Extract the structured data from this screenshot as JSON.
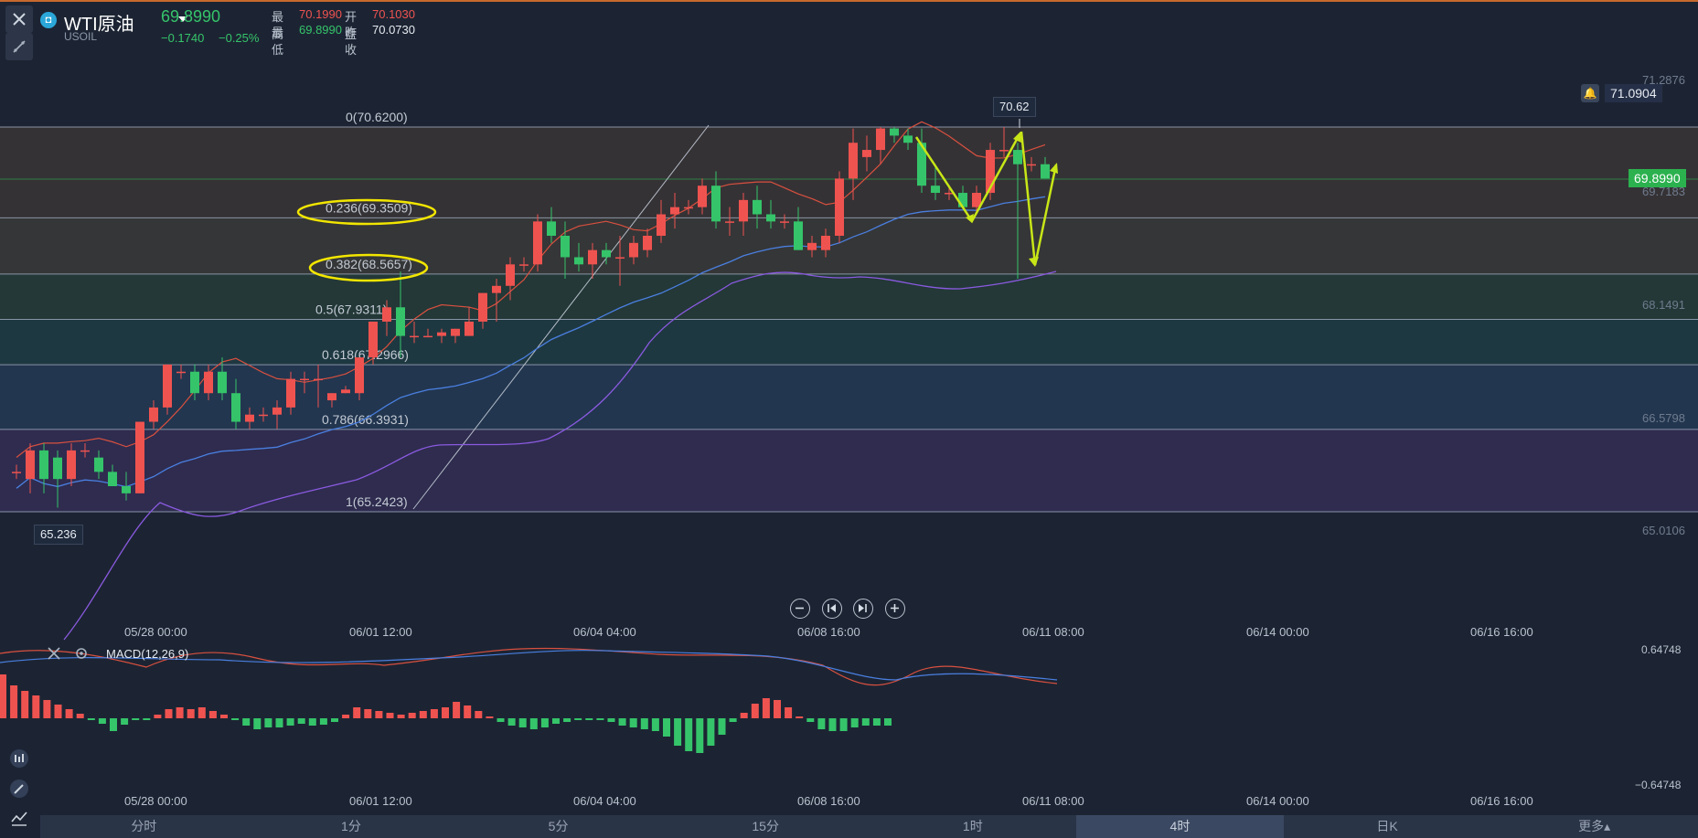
{
  "symbol": {
    "name": "WTI原油",
    "code": "USOIL",
    "price": "69.8990",
    "change": "−0.1740",
    "change_pct": "−0.25%",
    "icon": "symbol-logo-icon"
  },
  "stats": {
    "high_label": "最高",
    "high": "70.1990",
    "open_label": "开盘",
    "open": "70.1030",
    "low_label": "最低",
    "low": "69.8990",
    "prev_label": "昨收",
    "prev": "70.0730"
  },
  "fib_levels": [
    {
      "label": "0(70.6200)",
      "price": 70.62
    },
    {
      "label": "0.236(69.3509)",
      "price": 69.3509
    },
    {
      "label": "0.382(68.5657)",
      "price": 68.5657
    },
    {
      "label": "0.5(67.9311)",
      "price": 67.9311
    },
    {
      "label": "0.618(67.2966)",
      "price": 67.2966
    },
    {
      "label": "0.786(66.3931)",
      "price": 66.3931
    },
    {
      "label": "1(65.2423)",
      "price": 65.2423
    }
  ],
  "price_axis": [
    "71.2876",
    "69.7183",
    "68.1491",
    "66.5798",
    "65.0106"
  ],
  "alert_price": "71.0904",
  "current_price_tag": "69.8990",
  "high_marker": "70.62",
  "low_marker": "65.236",
  "time_axis": [
    "05/28 00:00",
    "06/01 12:00",
    "06/04 04:00",
    "06/08 16:00",
    "06/11 08:00",
    "06/14 00:00",
    "06/16 16:00"
  ],
  "macd": {
    "label": "MACD(12,26,9)",
    "top": "0.64748",
    "bottom": "−0.64748"
  },
  "tabs": [
    "分时",
    "1分",
    "5分",
    "15分",
    "1时",
    "4时",
    "日K",
    "更多▴"
  ],
  "active_tab": "4时",
  "colors": {
    "up": "#ef5350",
    "down": "#35c46a",
    "ma_blue": "#4a7fe0",
    "ma_purple": "#8a5ae0",
    "ma_red": "#d9503f",
    "annotation": "#c8e617",
    "ellipse": "#f2e600"
  },
  "chart_data": {
    "type": "candlestick",
    "series": [
      {
        "o": 65.8,
        "h": 65.9,
        "l": 65.7,
        "c": 65.8
      },
      {
        "o": 65.7,
        "h": 66.2,
        "l": 65.5,
        "c": 66.1
      },
      {
        "o": 66.1,
        "h": 66.2,
        "l": 65.5,
        "c": 65.7
      },
      {
        "o": 66.0,
        "h": 66.1,
        "l": 65.3,
        "c": 65.7
      },
      {
        "o": 65.7,
        "h": 66.2,
        "l": 65.6,
        "c": 66.1
      },
      {
        "o": 66.1,
        "h": 66.2,
        "l": 66.0,
        "c": 66.1
      },
      {
        "o": 66.0,
        "h": 66.1,
        "l": 65.7,
        "c": 65.8
      },
      {
        "o": 65.8,
        "h": 65.9,
        "l": 65.6,
        "c": 65.6
      },
      {
        "o": 65.6,
        "h": 65.8,
        "l": 65.4,
        "c": 65.5
      },
      {
        "o": 65.5,
        "h": 66.5,
        "l": 65.5,
        "c": 66.5
      },
      {
        "o": 66.5,
        "h": 66.8,
        "l": 66.4,
        "c": 66.7
      },
      {
        "o": 66.7,
        "h": 67.3,
        "l": 66.6,
        "c": 67.3
      },
      {
        "o": 67.2,
        "h": 67.3,
        "l": 67.1,
        "c": 67.2
      },
      {
        "o": 67.2,
        "h": 67.3,
        "l": 66.8,
        "c": 66.9
      },
      {
        "o": 66.9,
        "h": 67.3,
        "l": 66.8,
        "c": 67.2
      },
      {
        "o": 67.2,
        "h": 67.4,
        "l": 66.8,
        "c": 66.9
      },
      {
        "o": 66.9,
        "h": 67.1,
        "l": 66.4,
        "c": 66.5
      },
      {
        "o": 66.5,
        "h": 66.7,
        "l": 66.4,
        "c": 66.6
      },
      {
        "o": 66.6,
        "h": 66.7,
        "l": 66.5,
        "c": 66.6
      },
      {
        "o": 66.6,
        "h": 66.8,
        "l": 66.4,
        "c": 66.7
      },
      {
        "o": 66.7,
        "h": 67.2,
        "l": 66.6,
        "c": 67.1
      },
      {
        "o": 67.1,
        "h": 67.2,
        "l": 66.9,
        "c": 67.1
      },
      {
        "o": 67.1,
        "h": 67.3,
        "l": 66.7,
        "c": 67.1
      },
      {
        "o": 66.8,
        "h": 66.9,
        "l": 66.7,
        "c": 66.9
      },
      {
        "o": 66.9,
        "h": 67.0,
        "l": 66.9,
        "c": 66.95
      },
      {
        "o": 66.9,
        "h": 67.4,
        "l": 66.8,
        "c": 67.4
      },
      {
        "o": 67.4,
        "h": 67.9,
        "l": 67.3,
        "c": 67.9
      },
      {
        "o": 67.9,
        "h": 68.2,
        "l": 67.7,
        "c": 68.1
      },
      {
        "o": 68.1,
        "h": 68.6,
        "l": 67.4,
        "c": 67.7
      },
      {
        "o": 67.7,
        "h": 67.9,
        "l": 67.6,
        "c": 67.7
      },
      {
        "o": 67.7,
        "h": 67.8,
        "l": 67.7,
        "c": 67.7
      },
      {
        "o": 67.7,
        "h": 67.8,
        "l": 67.6,
        "c": 67.75
      },
      {
        "o": 67.7,
        "h": 67.8,
        "l": 67.6,
        "c": 67.8
      },
      {
        "o": 67.7,
        "h": 68.1,
        "l": 67.7,
        "c": 67.9
      },
      {
        "o": 67.9,
        "h": 68.3,
        "l": 67.8,
        "c": 68.3
      },
      {
        "o": 68.3,
        "h": 68.5,
        "l": 67.9,
        "c": 68.4
      },
      {
        "o": 68.4,
        "h": 68.8,
        "l": 68.2,
        "c": 68.7
      },
      {
        "o": 68.7,
        "h": 68.8,
        "l": 68.6,
        "c": 68.7
      },
      {
        "o": 68.7,
        "h": 69.4,
        "l": 68.6,
        "c": 69.3
      },
      {
        "o": 69.3,
        "h": 69.5,
        "l": 69.0,
        "c": 69.1
      },
      {
        "o": 69.1,
        "h": 69.3,
        "l": 68.5,
        "c": 68.8
      },
      {
        "o": 68.8,
        "h": 69.0,
        "l": 68.6,
        "c": 68.7
      },
      {
        "o": 68.7,
        "h": 69.0,
        "l": 68.5,
        "c": 68.9
      },
      {
        "o": 68.9,
        "h": 69.0,
        "l": 68.7,
        "c": 68.8
      },
      {
        "o": 68.8,
        "h": 69.1,
        "l": 68.4,
        "c": 68.8
      },
      {
        "o": 68.8,
        "h": 69.1,
        "l": 68.7,
        "c": 69.0
      },
      {
        "o": 68.9,
        "h": 69.2,
        "l": 68.8,
        "c": 69.1
      },
      {
        "o": 69.1,
        "h": 69.6,
        "l": 69.0,
        "c": 69.4
      },
      {
        "o": 69.4,
        "h": 69.7,
        "l": 69.2,
        "c": 69.5
      },
      {
        "o": 69.5,
        "h": 69.6,
        "l": 69.4,
        "c": 69.5
      },
      {
        "o": 69.5,
        "h": 69.9,
        "l": 69.4,
        "c": 69.8
      },
      {
        "o": 69.8,
        "h": 70.0,
        "l": 69.2,
        "c": 69.3
      },
      {
        "o": 69.3,
        "h": 69.5,
        "l": 69.1,
        "c": 69.3
      },
      {
        "o": 69.3,
        "h": 69.7,
        "l": 69.1,
        "c": 69.6
      },
      {
        "o": 69.6,
        "h": 69.8,
        "l": 69.2,
        "c": 69.4
      },
      {
        "o": 69.4,
        "h": 69.6,
        "l": 69.2,
        "c": 69.3
      },
      {
        "o": 69.3,
        "h": 69.4,
        "l": 69.2,
        "c": 69.3
      },
      {
        "o": 69.3,
        "h": 69.5,
        "l": 68.9,
        "c": 68.9
      },
      {
        "o": 68.9,
        "h": 69.1,
        "l": 68.8,
        "c": 69.0
      },
      {
        "o": 68.9,
        "h": 69.2,
        "l": 68.8,
        "c": 69.1
      },
      {
        "o": 69.1,
        "h": 70.0,
        "l": 69.0,
        "c": 69.9
      },
      {
        "o": 69.9,
        "h": 70.6,
        "l": 69.6,
        "c": 70.4
      },
      {
        "o": 70.2,
        "h": 70.5,
        "l": 70.0,
        "c": 70.3
      },
      {
        "o": 70.3,
        "h": 70.62,
        "l": 70.1,
        "c": 70.6
      },
      {
        "o": 70.6,
        "h": 70.62,
        "l": 70.4,
        "c": 70.5
      },
      {
        "o": 70.5,
        "h": 70.6,
        "l": 70.3,
        "c": 70.4
      },
      {
        "o": 70.4,
        "h": 70.6,
        "l": 69.7,
        "c": 69.8
      },
      {
        "o": 69.8,
        "h": 70.1,
        "l": 69.6,
        "c": 69.7
      },
      {
        "o": 69.7,
        "h": 69.8,
        "l": 69.6,
        "c": 69.7
      },
      {
        "o": 69.7,
        "h": 69.8,
        "l": 69.5,
        "c": 69.5
      },
      {
        "o": 69.5,
        "h": 69.8,
        "l": 69.4,
        "c": 69.7
      },
      {
        "o": 69.7,
        "h": 70.4,
        "l": 69.6,
        "c": 70.3
      },
      {
        "o": 70.3,
        "h": 70.62,
        "l": 70.2,
        "c": 70.3
      },
      {
        "o": 70.3,
        "h": 70.4,
        "l": 68.5,
        "c": 70.1
      },
      {
        "o": 70.1,
        "h": 70.2,
        "l": 70.0,
        "c": 70.1
      },
      {
        "o": 70.1,
        "h": 70.2,
        "l": 69.9,
        "c": 69.9
      }
    ],
    "ylim": [
      64.5,
      71.4
    ]
  }
}
